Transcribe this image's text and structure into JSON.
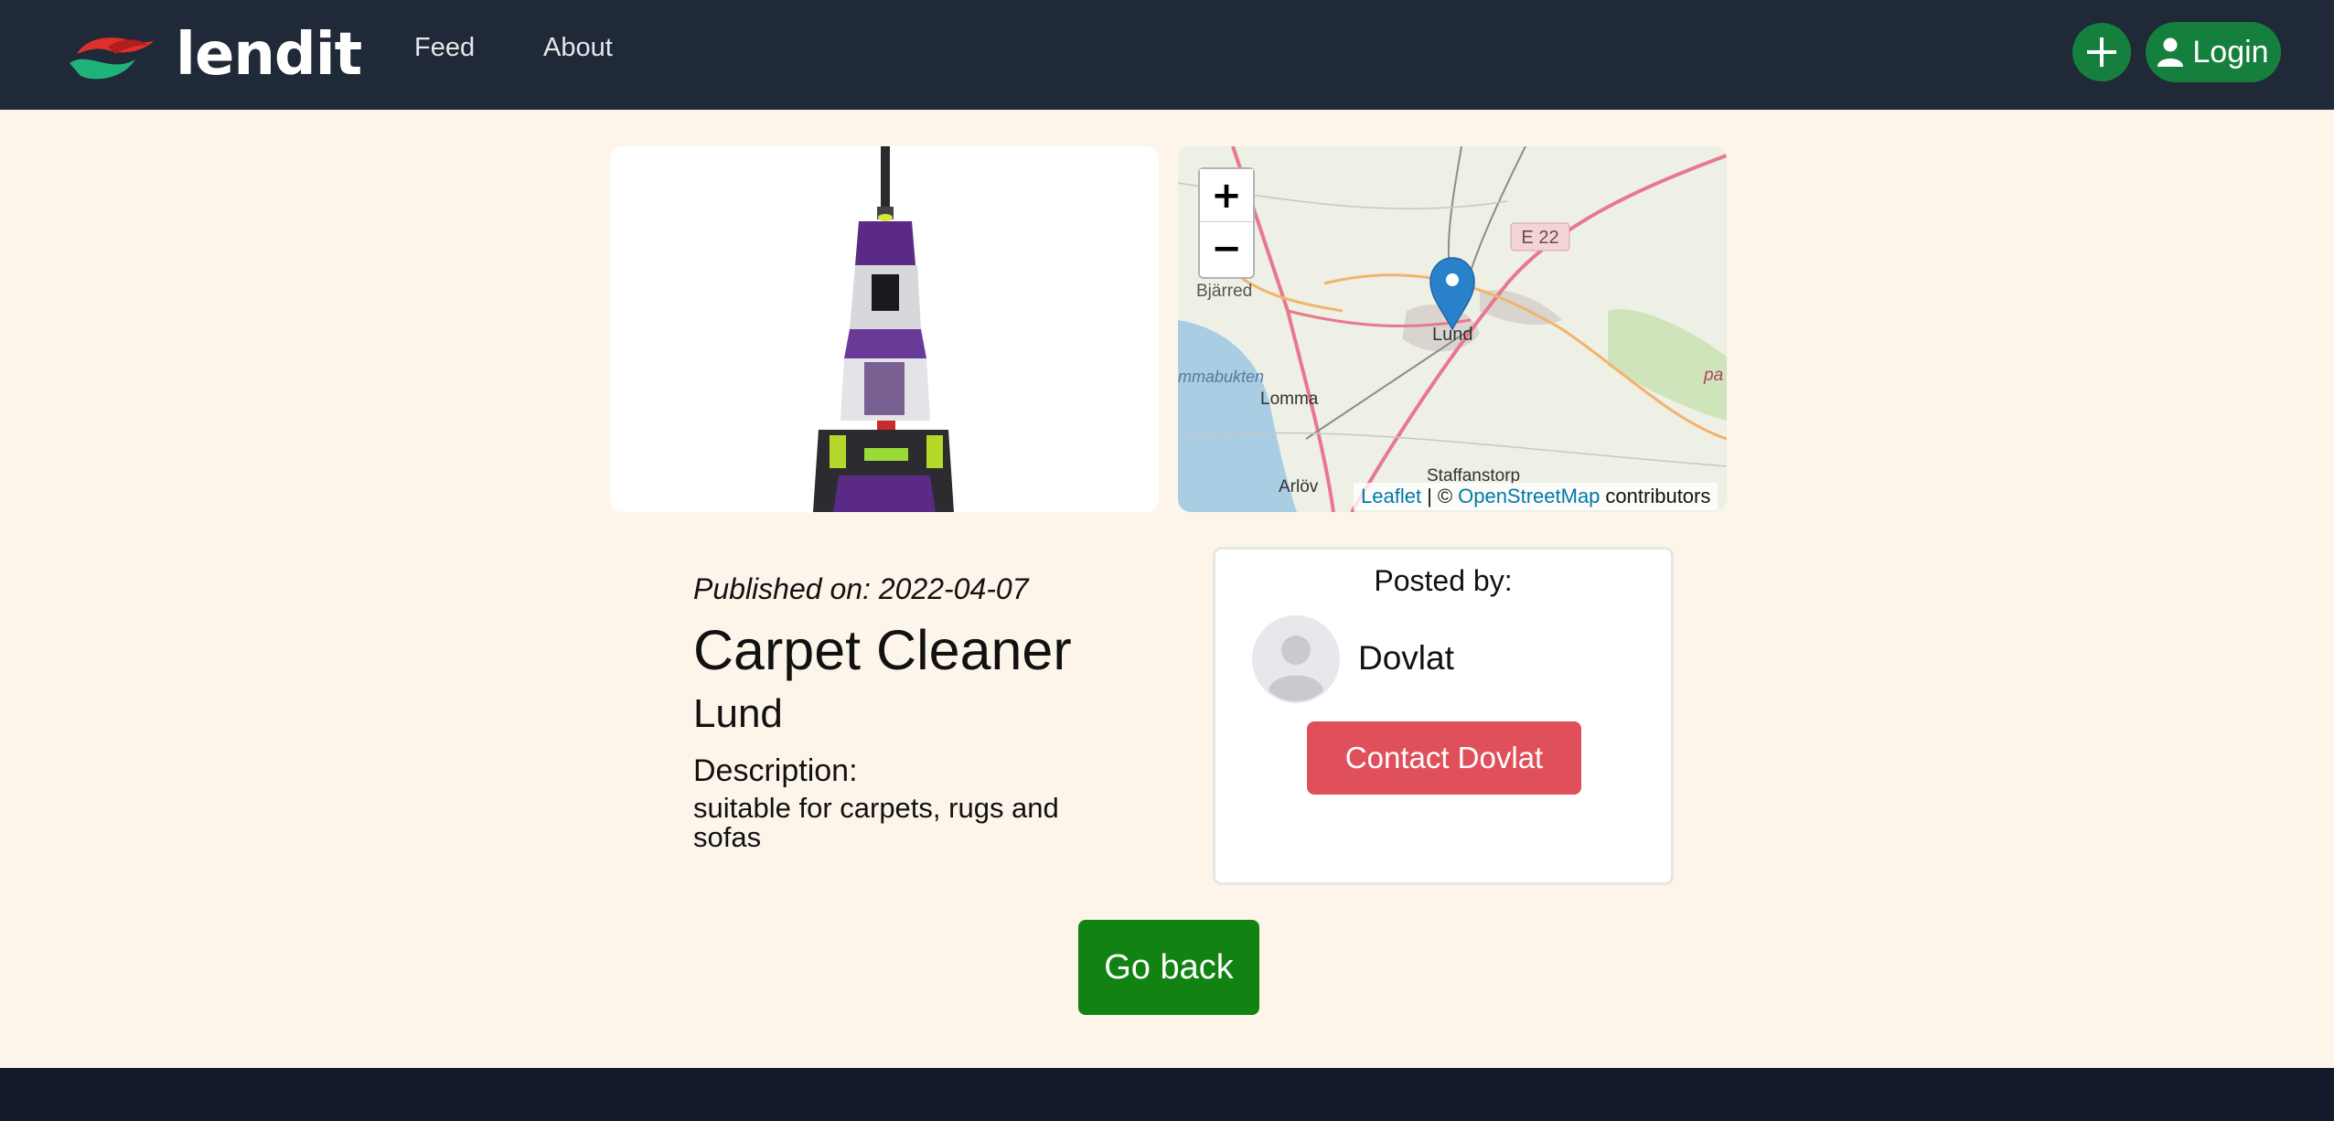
{
  "nav": {
    "brand": "lendit",
    "links": [
      {
        "label": "Feed"
      },
      {
        "label": "About"
      }
    ],
    "add_icon": "plus-icon",
    "login_label": "Login",
    "login_icon": "user-icon",
    "colors": {
      "bar": "#1f2937",
      "accent": "#15803d"
    }
  },
  "listing": {
    "image_alt": "Carpet Cleaner",
    "published": "Published on: 2022-04-07",
    "title": "Carpet Cleaner",
    "location": "Lund",
    "description_label": "Description:",
    "description": "suitable for carpets, rugs and sofas"
  },
  "map": {
    "zoom_in": "+",
    "zoom_out": "−",
    "attribution": {
      "leaflet": "Leaflet",
      "separator": "| ©",
      "osm": "OpenStreetMap",
      "suffix": "contributors"
    },
    "marker_icon": "map-pin-icon",
    "labels": {
      "highway": "E 22",
      "town1": "Bjärred",
      "city": "Lund",
      "bay": "mmabukten",
      "town2": "Lomma",
      "town3": "Arlöv",
      "town4": "Staffanstorp",
      "edge": "pa"
    }
  },
  "poster": {
    "heading": "Posted by:",
    "name": "Dovlat",
    "avatar_icon": "avatar-placeholder-icon",
    "contact_label": "Contact Dovlat",
    "contact_color": "#e0505a"
  },
  "actions": {
    "back_label": "Go back",
    "back_color": "#128212"
  }
}
